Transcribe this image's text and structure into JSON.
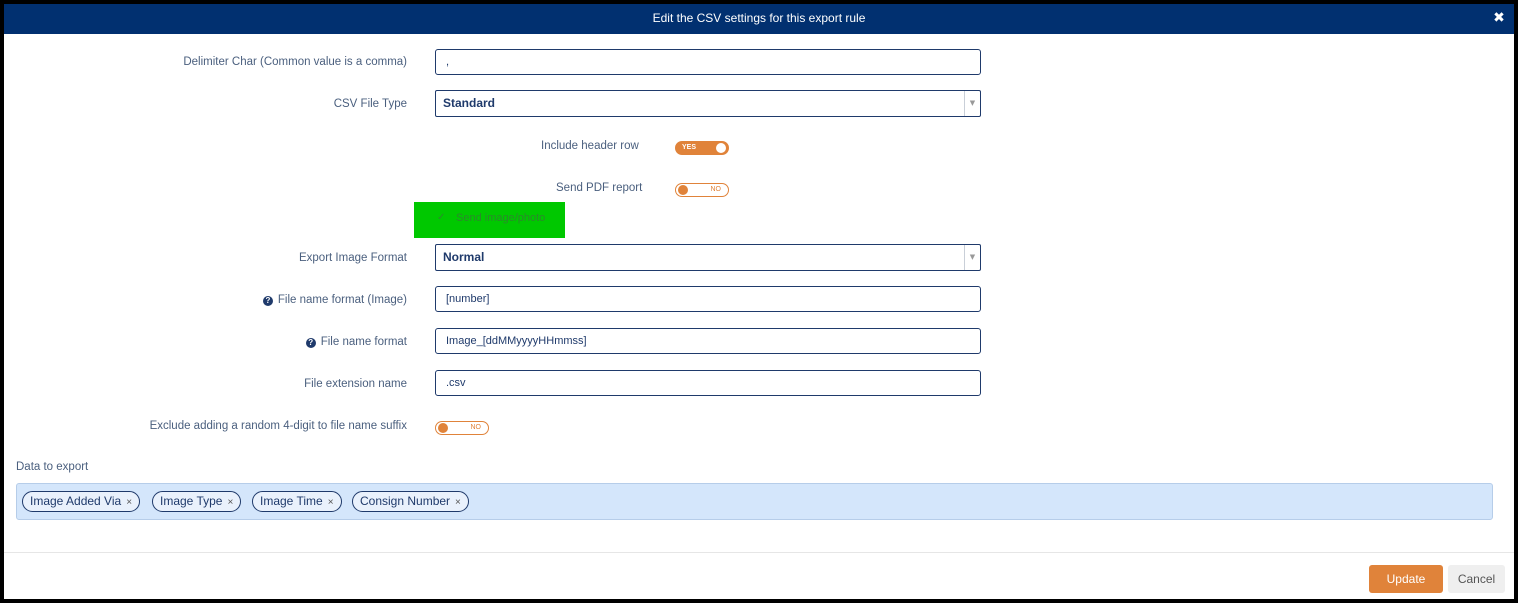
{
  "dialog": {
    "title": "Edit the CSV settings for this export rule",
    "close_icon": "close-x-icon",
    "colors": {
      "header": "#013070",
      "accent": "#e0833a",
      "tag_area": "#d4e6fb",
      "highlight": "#00c800"
    }
  },
  "fields": {
    "delimiter": {
      "label": "Delimiter Char (Common value is a comma)",
      "value": ","
    },
    "csv_file_type": {
      "label": "CSV File Type",
      "value": "Standard"
    },
    "include_header_row": {
      "label": "Include header row",
      "state": "YES"
    },
    "send_pdf_report": {
      "label": "Send PDF report",
      "state": "NO"
    },
    "send_image_photo": {
      "label": "Send image/photo",
      "checked": true
    },
    "export_image_format": {
      "label": "Export Image Format",
      "value": "Normal"
    },
    "file_name_format_image": {
      "label": "File name format (Image)",
      "value": "[number]"
    },
    "file_name_format": {
      "label": "File name format",
      "value": "Image_[ddMMyyyyHHmmss]"
    },
    "file_extension_name": {
      "label": "File extension name",
      "value": ".csv"
    },
    "exclude_random_suffix": {
      "label": "Exclude adding a random 4-digit to file name suffix",
      "state": "NO"
    }
  },
  "data_to_export": {
    "label": "Data to export",
    "tags": [
      {
        "label": "Image Added Via",
        "remove": "×"
      },
      {
        "label": "Image Type",
        "remove": "×"
      },
      {
        "label": "Image Time",
        "remove": "×"
      },
      {
        "label": "Consign Number",
        "remove": "×"
      }
    ]
  },
  "footer": {
    "update_label": "Update",
    "cancel_label": "Cancel"
  }
}
